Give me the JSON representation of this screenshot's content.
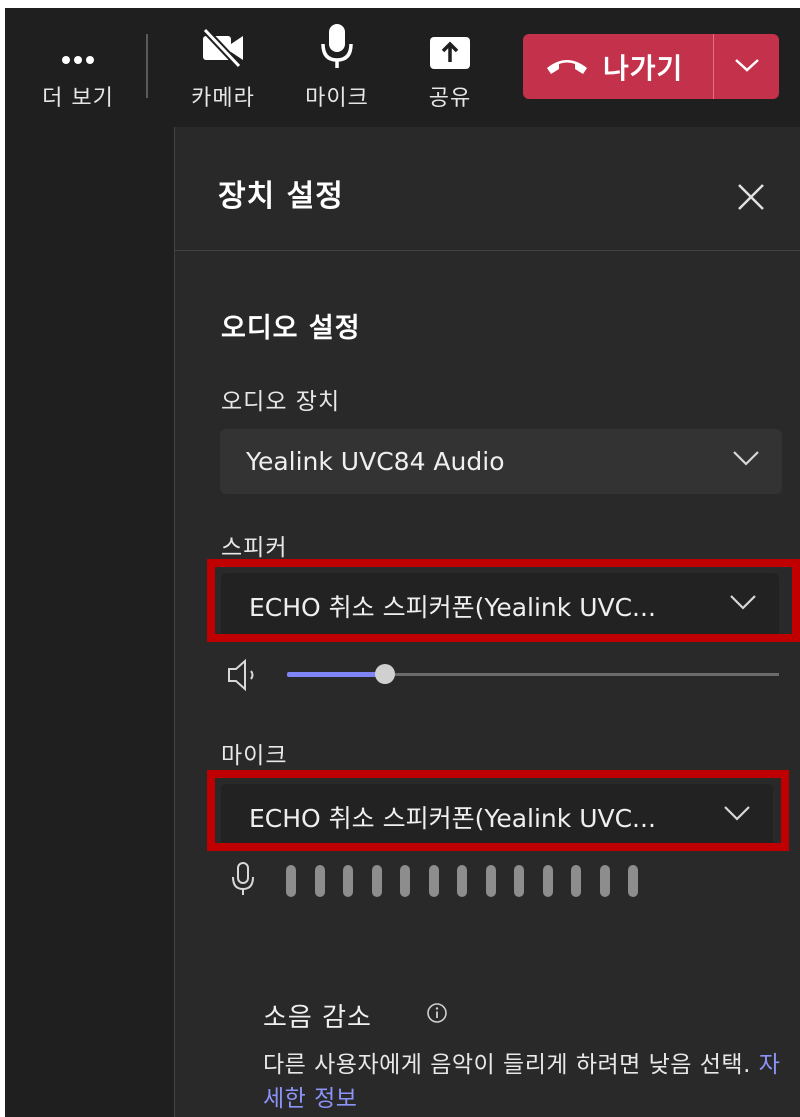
{
  "toolbar": {
    "more_label": "더 보기",
    "camera_label": "카메라",
    "mic_label": "마이크",
    "share_label": "공유",
    "leave_label": "나가기"
  },
  "panel": {
    "title": "장치 설정",
    "audio_section_title": "오디오 설정",
    "audio_device": {
      "label": "오디오 장치",
      "value": "Yealink UVC84 Audio"
    },
    "speaker": {
      "label": "스피커",
      "value": "ECHO 취소 스피커폰(Yealink UVC...",
      "volume_fraction": 0.2
    },
    "microphone": {
      "label": "마이크",
      "value": "ECHO 취소 스피커폰(Yealink UVC...",
      "level_bars": 13,
      "active_bars": 0
    },
    "noise_suppression": {
      "label": "소음 감소",
      "description": "다른 사용자에게 음악이 들리게 하려면 낮음 선택.",
      "link_text": "자세한 정보"
    }
  },
  "colors": {
    "leave_button": "#c4314b",
    "slider_fill": "#7f85f5",
    "highlight_box": "#c00000",
    "link": "#8c93f7"
  },
  "icons": [
    "more-icon",
    "camera-off-icon",
    "microphone-icon",
    "share-icon",
    "hang-up-icon",
    "chevron-down-icon",
    "close-icon",
    "speaker-icon",
    "info-icon"
  ]
}
